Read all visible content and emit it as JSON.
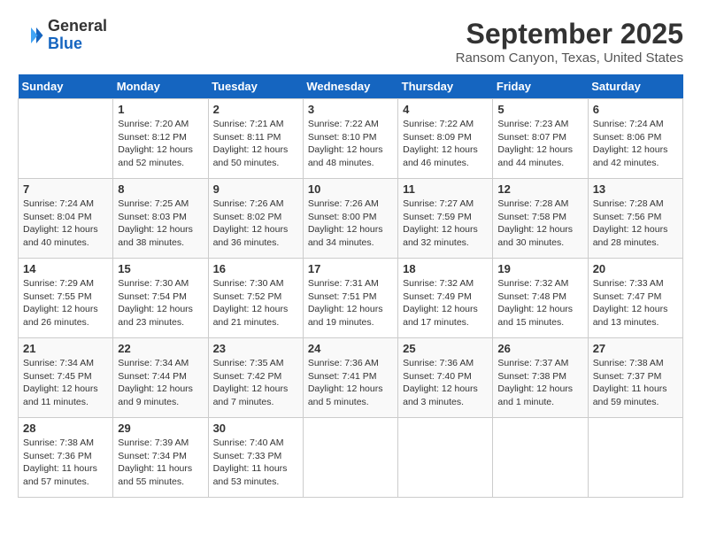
{
  "header": {
    "logo_general": "General",
    "logo_blue": "Blue",
    "month_title": "September 2025",
    "location": "Ransom Canyon, Texas, United States"
  },
  "weekdays": [
    "Sunday",
    "Monday",
    "Tuesday",
    "Wednesday",
    "Thursday",
    "Friday",
    "Saturday"
  ],
  "weeks": [
    [
      {
        "day": null
      },
      {
        "day": 1,
        "sunrise": "7:20 AM",
        "sunset": "8:12 PM",
        "daylight": "12 hours and 52 minutes."
      },
      {
        "day": 2,
        "sunrise": "7:21 AM",
        "sunset": "8:11 PM",
        "daylight": "12 hours and 50 minutes."
      },
      {
        "day": 3,
        "sunrise": "7:22 AM",
        "sunset": "8:10 PM",
        "daylight": "12 hours and 48 minutes."
      },
      {
        "day": 4,
        "sunrise": "7:22 AM",
        "sunset": "8:09 PM",
        "daylight": "12 hours and 46 minutes."
      },
      {
        "day": 5,
        "sunrise": "7:23 AM",
        "sunset": "8:07 PM",
        "daylight": "12 hours and 44 minutes."
      },
      {
        "day": 6,
        "sunrise": "7:24 AM",
        "sunset": "8:06 PM",
        "daylight": "12 hours and 42 minutes."
      }
    ],
    [
      {
        "day": 7,
        "sunrise": "7:24 AM",
        "sunset": "8:04 PM",
        "daylight": "12 hours and 40 minutes."
      },
      {
        "day": 8,
        "sunrise": "7:25 AM",
        "sunset": "8:03 PM",
        "daylight": "12 hours and 38 minutes."
      },
      {
        "day": 9,
        "sunrise": "7:26 AM",
        "sunset": "8:02 PM",
        "daylight": "12 hours and 36 minutes."
      },
      {
        "day": 10,
        "sunrise": "7:26 AM",
        "sunset": "8:00 PM",
        "daylight": "12 hours and 34 minutes."
      },
      {
        "day": 11,
        "sunrise": "7:27 AM",
        "sunset": "7:59 PM",
        "daylight": "12 hours and 32 minutes."
      },
      {
        "day": 12,
        "sunrise": "7:28 AM",
        "sunset": "7:58 PM",
        "daylight": "12 hours and 30 minutes."
      },
      {
        "day": 13,
        "sunrise": "7:28 AM",
        "sunset": "7:56 PM",
        "daylight": "12 hours and 28 minutes."
      }
    ],
    [
      {
        "day": 14,
        "sunrise": "7:29 AM",
        "sunset": "7:55 PM",
        "daylight": "12 hours and 26 minutes."
      },
      {
        "day": 15,
        "sunrise": "7:30 AM",
        "sunset": "7:54 PM",
        "daylight": "12 hours and 23 minutes."
      },
      {
        "day": 16,
        "sunrise": "7:30 AM",
        "sunset": "7:52 PM",
        "daylight": "12 hours and 21 minutes."
      },
      {
        "day": 17,
        "sunrise": "7:31 AM",
        "sunset": "7:51 PM",
        "daylight": "12 hours and 19 minutes."
      },
      {
        "day": 18,
        "sunrise": "7:32 AM",
        "sunset": "7:49 PM",
        "daylight": "12 hours and 17 minutes."
      },
      {
        "day": 19,
        "sunrise": "7:32 AM",
        "sunset": "7:48 PM",
        "daylight": "12 hours and 15 minutes."
      },
      {
        "day": 20,
        "sunrise": "7:33 AM",
        "sunset": "7:47 PM",
        "daylight": "12 hours and 13 minutes."
      }
    ],
    [
      {
        "day": 21,
        "sunrise": "7:34 AM",
        "sunset": "7:45 PM",
        "daylight": "12 hours and 11 minutes."
      },
      {
        "day": 22,
        "sunrise": "7:34 AM",
        "sunset": "7:44 PM",
        "daylight": "12 hours and 9 minutes."
      },
      {
        "day": 23,
        "sunrise": "7:35 AM",
        "sunset": "7:42 PM",
        "daylight": "12 hours and 7 minutes."
      },
      {
        "day": 24,
        "sunrise": "7:36 AM",
        "sunset": "7:41 PM",
        "daylight": "12 hours and 5 minutes."
      },
      {
        "day": 25,
        "sunrise": "7:36 AM",
        "sunset": "7:40 PM",
        "daylight": "12 hours and 3 minutes."
      },
      {
        "day": 26,
        "sunrise": "7:37 AM",
        "sunset": "7:38 PM",
        "daylight": "12 hours and 1 minute."
      },
      {
        "day": 27,
        "sunrise": "7:38 AM",
        "sunset": "7:37 PM",
        "daylight": "11 hours and 59 minutes."
      }
    ],
    [
      {
        "day": 28,
        "sunrise": "7:38 AM",
        "sunset": "7:36 PM",
        "daylight": "11 hours and 57 minutes."
      },
      {
        "day": 29,
        "sunrise": "7:39 AM",
        "sunset": "7:34 PM",
        "daylight": "11 hours and 55 minutes."
      },
      {
        "day": 30,
        "sunrise": "7:40 AM",
        "sunset": "7:33 PM",
        "daylight": "11 hours and 53 minutes."
      },
      {
        "day": null
      },
      {
        "day": null
      },
      {
        "day": null
      },
      {
        "day": null
      }
    ]
  ]
}
